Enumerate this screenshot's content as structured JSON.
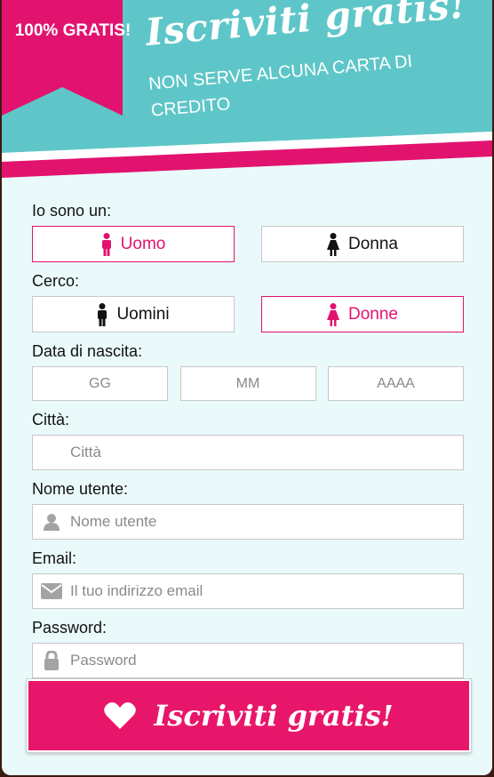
{
  "header": {
    "badge": "100% GRATIS!",
    "title": "Iscriviti gratis!",
    "subtitle": "NON SERVE ALCUNA CARTA DI CREDITO"
  },
  "form": {
    "gender_label": "Io sono un:",
    "gender_options": [
      {
        "label": "Uomo",
        "icon": "male-icon",
        "selected": true
      },
      {
        "label": "Donna",
        "icon": "female-icon",
        "selected": false
      }
    ],
    "seek_label": "Cerco:",
    "seek_options": [
      {
        "label": "Uomini",
        "icon": "male-icon",
        "selected": false
      },
      {
        "label": "Donne",
        "icon": "female-icon",
        "selected": true
      }
    ],
    "birth_label": "Data di nascita:",
    "birth_day_placeholder": "GG",
    "birth_month_placeholder": "MM",
    "birth_year_placeholder": "AAAA",
    "city_label": "Città:",
    "city_placeholder": "Città",
    "username_label": "Nome utente:",
    "username_placeholder": "Nome utente",
    "email_label": "Email:",
    "email_placeholder": "Il tuo indirizzo email",
    "password_label": "Password:",
    "password_placeholder": "Password"
  },
  "submit": {
    "label": "Iscriviti gratis!",
    "icon": "heart-icon"
  },
  "colors": {
    "accent": "#e2136e",
    "teal": "#5ec6c8",
    "panel": "#eafafb"
  }
}
